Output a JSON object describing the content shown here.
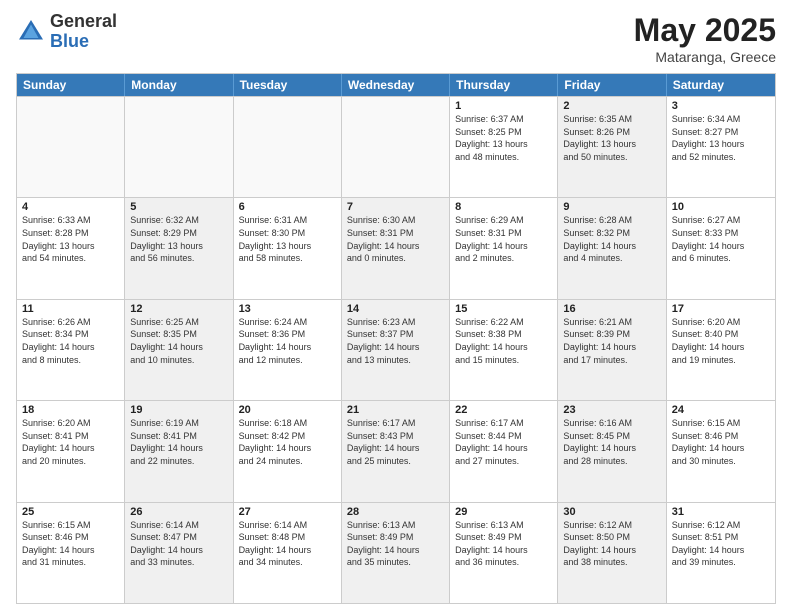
{
  "header": {
    "logo_general": "General",
    "logo_blue": "Blue",
    "title": "May 2025",
    "location": "Mataranga, Greece"
  },
  "days_of_week": [
    "Sunday",
    "Monday",
    "Tuesday",
    "Wednesday",
    "Thursday",
    "Friday",
    "Saturday"
  ],
  "rows": [
    [
      {
        "day": "",
        "info": "",
        "empty": true
      },
      {
        "day": "",
        "info": "",
        "empty": true
      },
      {
        "day": "",
        "info": "",
        "empty": true
      },
      {
        "day": "",
        "info": "",
        "empty": true
      },
      {
        "day": "1",
        "info": "Sunrise: 6:37 AM\nSunset: 8:25 PM\nDaylight: 13 hours\nand 48 minutes.",
        "shaded": false
      },
      {
        "day": "2",
        "info": "Sunrise: 6:35 AM\nSunset: 8:26 PM\nDaylight: 13 hours\nand 50 minutes.",
        "shaded": true
      },
      {
        "day": "3",
        "info": "Sunrise: 6:34 AM\nSunset: 8:27 PM\nDaylight: 13 hours\nand 52 minutes.",
        "shaded": false
      }
    ],
    [
      {
        "day": "4",
        "info": "Sunrise: 6:33 AM\nSunset: 8:28 PM\nDaylight: 13 hours\nand 54 minutes.",
        "shaded": false
      },
      {
        "day": "5",
        "info": "Sunrise: 6:32 AM\nSunset: 8:29 PM\nDaylight: 13 hours\nand 56 minutes.",
        "shaded": true
      },
      {
        "day": "6",
        "info": "Sunrise: 6:31 AM\nSunset: 8:30 PM\nDaylight: 13 hours\nand 58 minutes.",
        "shaded": false
      },
      {
        "day": "7",
        "info": "Sunrise: 6:30 AM\nSunset: 8:31 PM\nDaylight: 14 hours\nand 0 minutes.",
        "shaded": true
      },
      {
        "day": "8",
        "info": "Sunrise: 6:29 AM\nSunset: 8:31 PM\nDaylight: 14 hours\nand 2 minutes.",
        "shaded": false
      },
      {
        "day": "9",
        "info": "Sunrise: 6:28 AM\nSunset: 8:32 PM\nDaylight: 14 hours\nand 4 minutes.",
        "shaded": true
      },
      {
        "day": "10",
        "info": "Sunrise: 6:27 AM\nSunset: 8:33 PM\nDaylight: 14 hours\nand 6 minutes.",
        "shaded": false
      }
    ],
    [
      {
        "day": "11",
        "info": "Sunrise: 6:26 AM\nSunset: 8:34 PM\nDaylight: 14 hours\nand 8 minutes.",
        "shaded": false
      },
      {
        "day": "12",
        "info": "Sunrise: 6:25 AM\nSunset: 8:35 PM\nDaylight: 14 hours\nand 10 minutes.",
        "shaded": true
      },
      {
        "day": "13",
        "info": "Sunrise: 6:24 AM\nSunset: 8:36 PM\nDaylight: 14 hours\nand 12 minutes.",
        "shaded": false
      },
      {
        "day": "14",
        "info": "Sunrise: 6:23 AM\nSunset: 8:37 PM\nDaylight: 14 hours\nand 13 minutes.",
        "shaded": true
      },
      {
        "day": "15",
        "info": "Sunrise: 6:22 AM\nSunset: 8:38 PM\nDaylight: 14 hours\nand 15 minutes.",
        "shaded": false
      },
      {
        "day": "16",
        "info": "Sunrise: 6:21 AM\nSunset: 8:39 PM\nDaylight: 14 hours\nand 17 minutes.",
        "shaded": true
      },
      {
        "day": "17",
        "info": "Sunrise: 6:20 AM\nSunset: 8:40 PM\nDaylight: 14 hours\nand 19 minutes.",
        "shaded": false
      }
    ],
    [
      {
        "day": "18",
        "info": "Sunrise: 6:20 AM\nSunset: 8:41 PM\nDaylight: 14 hours\nand 20 minutes.",
        "shaded": false
      },
      {
        "day": "19",
        "info": "Sunrise: 6:19 AM\nSunset: 8:41 PM\nDaylight: 14 hours\nand 22 minutes.",
        "shaded": true
      },
      {
        "day": "20",
        "info": "Sunrise: 6:18 AM\nSunset: 8:42 PM\nDaylight: 14 hours\nand 24 minutes.",
        "shaded": false
      },
      {
        "day": "21",
        "info": "Sunrise: 6:17 AM\nSunset: 8:43 PM\nDaylight: 14 hours\nand 25 minutes.",
        "shaded": true
      },
      {
        "day": "22",
        "info": "Sunrise: 6:17 AM\nSunset: 8:44 PM\nDaylight: 14 hours\nand 27 minutes.",
        "shaded": false
      },
      {
        "day": "23",
        "info": "Sunrise: 6:16 AM\nSunset: 8:45 PM\nDaylight: 14 hours\nand 28 minutes.",
        "shaded": true
      },
      {
        "day": "24",
        "info": "Sunrise: 6:15 AM\nSunset: 8:46 PM\nDaylight: 14 hours\nand 30 minutes.",
        "shaded": false
      }
    ],
    [
      {
        "day": "25",
        "info": "Sunrise: 6:15 AM\nSunset: 8:46 PM\nDaylight: 14 hours\nand 31 minutes.",
        "shaded": false
      },
      {
        "day": "26",
        "info": "Sunrise: 6:14 AM\nSunset: 8:47 PM\nDaylight: 14 hours\nand 33 minutes.",
        "shaded": true
      },
      {
        "day": "27",
        "info": "Sunrise: 6:14 AM\nSunset: 8:48 PM\nDaylight: 14 hours\nand 34 minutes.",
        "shaded": false
      },
      {
        "day": "28",
        "info": "Sunrise: 6:13 AM\nSunset: 8:49 PM\nDaylight: 14 hours\nand 35 minutes.",
        "shaded": true
      },
      {
        "day": "29",
        "info": "Sunrise: 6:13 AM\nSunset: 8:49 PM\nDaylight: 14 hours\nand 36 minutes.",
        "shaded": false
      },
      {
        "day": "30",
        "info": "Sunrise: 6:12 AM\nSunset: 8:50 PM\nDaylight: 14 hours\nand 38 minutes.",
        "shaded": true
      },
      {
        "day": "31",
        "info": "Sunrise: 6:12 AM\nSunset: 8:51 PM\nDaylight: 14 hours\nand 39 minutes.",
        "shaded": false
      }
    ]
  ]
}
